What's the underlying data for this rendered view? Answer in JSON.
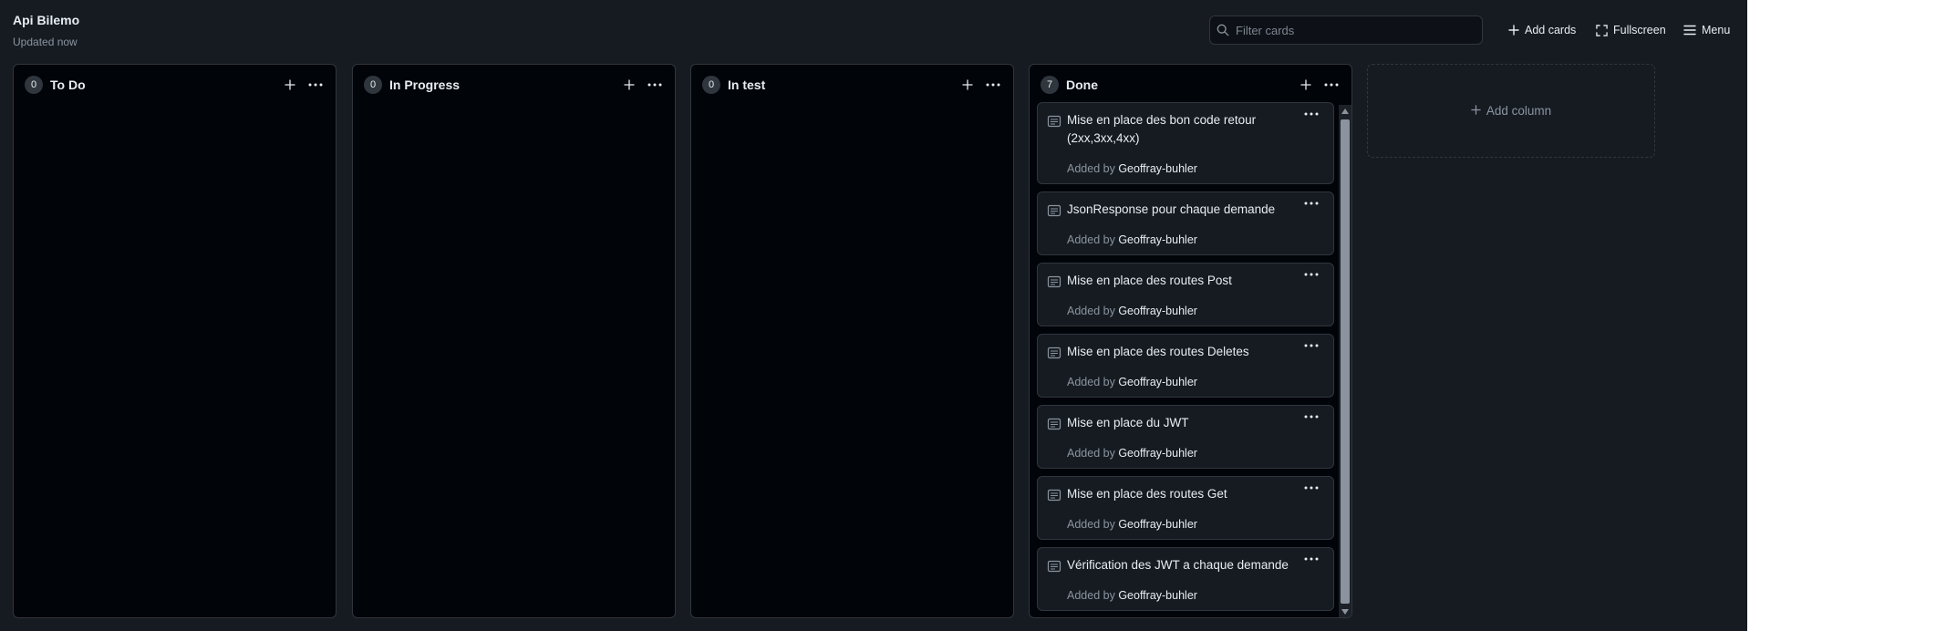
{
  "project": {
    "title": "Api Bilemo",
    "updated": "Updated now"
  },
  "header": {
    "filter_placeholder": "Filter cards",
    "add_cards": "Add cards",
    "fullscreen": "Fullscreen",
    "menu": "Menu"
  },
  "columns": [
    {
      "name": "To Do",
      "count": "0"
    },
    {
      "name": "In Progress",
      "count": "0"
    },
    {
      "name": "In test",
      "count": "0"
    },
    {
      "name": "Done",
      "count": "7"
    }
  ],
  "cards": [
    {
      "title": "Mise en place des bon code retour (2xx,3xx,4xx)",
      "added_by_label": "Added by",
      "author": "Geoffray-buhler"
    },
    {
      "title": "JsonResponse pour chaque demande",
      "added_by_label": "Added by",
      "author": "Geoffray-buhler"
    },
    {
      "title": "Mise en place des routes Post",
      "added_by_label": "Added by",
      "author": "Geoffray-buhler"
    },
    {
      "title": "Mise en place des routes Deletes",
      "added_by_label": "Added by",
      "author": "Geoffray-buhler"
    },
    {
      "title": "Mise en place du JWT",
      "added_by_label": "Added by",
      "author": "Geoffray-buhler"
    },
    {
      "title": "Mise en place des routes Get",
      "added_by_label": "Added by",
      "author": "Geoffray-buhler"
    },
    {
      "title": "Vérification des JWT a chaque demande",
      "added_by_label": "Added by",
      "author": "Geoffray-buhler"
    }
  ],
  "add_column": {
    "label": "Add column"
  },
  "colors": {
    "background": "#161b22",
    "column_bg": "#010409",
    "border": "#30363d",
    "text": "#e6edf3",
    "muted": "#8b949e"
  }
}
